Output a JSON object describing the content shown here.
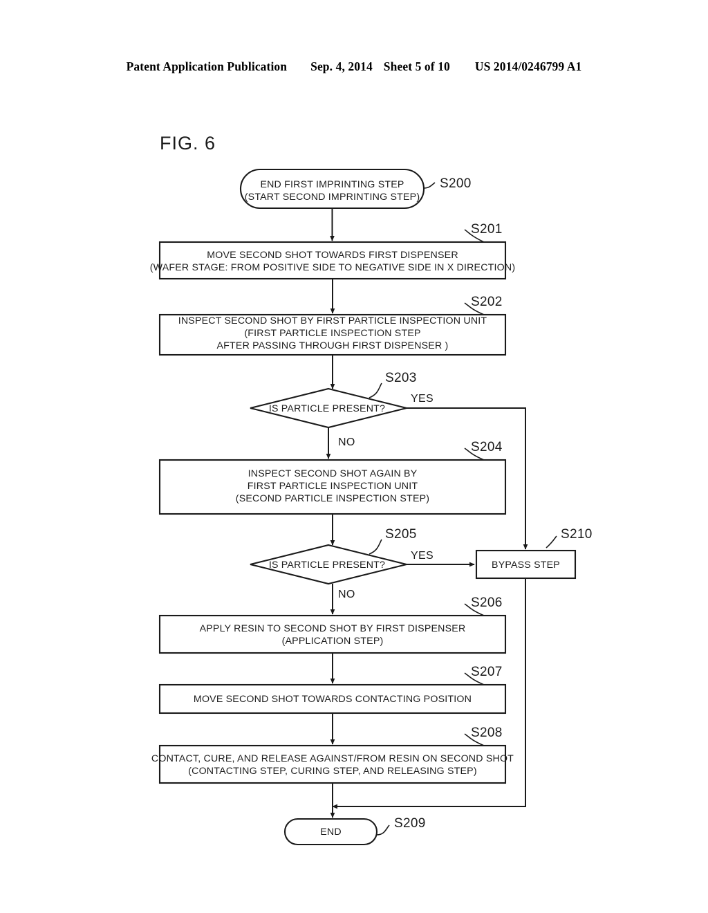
{
  "header": {
    "publication": "Patent Application Publication",
    "date": "Sep. 4, 2014",
    "sheet": "Sheet 5 of 10",
    "patent_number": "US 2014/0246799 A1"
  },
  "figure": {
    "title": "FIG. 6"
  },
  "flowchart": {
    "nodes": {
      "s200": {
        "id": "S200",
        "shape": "terminal",
        "line1": "END FIRST IMPRINTING STEP",
        "line2": "(START SECOND IMPRINTING STEP)"
      },
      "s201": {
        "id": "S201",
        "shape": "process",
        "line1": "MOVE SECOND SHOT TOWARDS FIRST DISPENSER",
        "line2": "(WAFER STAGE: FROM POSITIVE SIDE TO NEGATIVE SIDE IN X DIRECTION)"
      },
      "s202": {
        "id": "S202",
        "shape": "process",
        "line1": "INSPECT SECOND SHOT BY FIRST PARTICLE INSPECTION UNIT",
        "line2": "(FIRST PARTICLE INSPECTION STEP",
        "line3": "AFTER PASSING THROUGH FIRST DISPENSER )"
      },
      "s203": {
        "id": "S203",
        "shape": "decision",
        "line1": "IS PARTICLE PRESENT?",
        "yes": "YES",
        "no": "NO"
      },
      "s204": {
        "id": "S204",
        "shape": "process",
        "line1": "INSPECT SECOND SHOT AGAIN BY",
        "line2": "FIRST PARTICLE INSPECTION UNIT",
        "line3": "(SECOND PARTICLE INSPECTION STEP)"
      },
      "s205": {
        "id": "S205",
        "shape": "decision",
        "line1": "IS PARTICLE PRESENT?",
        "yes": "YES",
        "no": "NO"
      },
      "s206": {
        "id": "S206",
        "shape": "process",
        "line1": "APPLY RESIN TO SECOND SHOT BY FIRST DISPENSER",
        "line2": "(APPLICATION STEP)"
      },
      "s207": {
        "id": "S207",
        "shape": "process",
        "line1": "MOVE SECOND SHOT TOWARDS CONTACTING POSITION"
      },
      "s208": {
        "id": "S208",
        "shape": "process",
        "line1": "CONTACT, CURE, AND RELEASE AGAINST/FROM RESIN ON SECOND SHOT",
        "line2": "(CONTACTING STEP, CURING STEP, AND RELEASING STEP)"
      },
      "s209": {
        "id": "S209",
        "shape": "terminal",
        "line1": "END"
      },
      "s210": {
        "id": "S210",
        "shape": "process",
        "line1": "BYPASS STEP"
      }
    }
  },
  "colors": {
    "ink": "#1a1a1a",
    "paper": "#ffffff"
  }
}
